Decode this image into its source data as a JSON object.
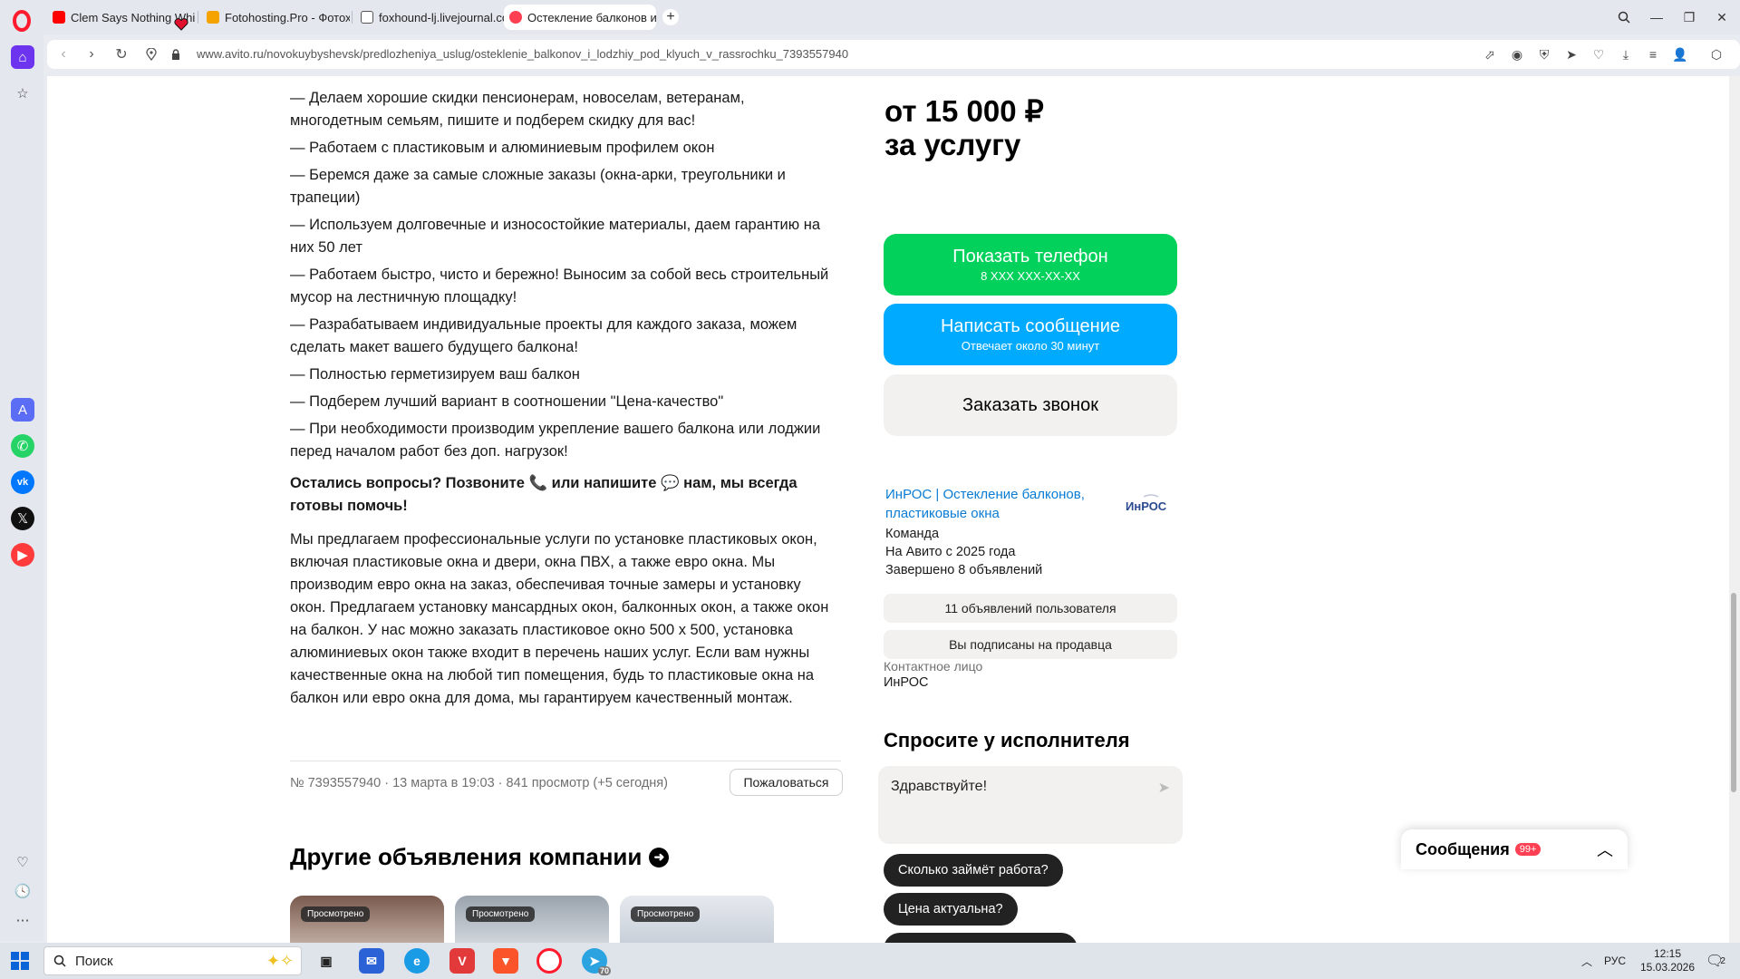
{
  "browser": {
    "tabs": [
      {
        "label": "Clem Says Nothing While",
        "color": "#ff0000"
      },
      {
        "label": "Fotohosting.Pro - Фотохо",
        "color": "#f5a300"
      },
      {
        "label": "foxhound-lj.livejournal.co",
        "color": "#555555"
      },
      {
        "label": "Остекление балконов и",
        "color": "#ff4053"
      }
    ],
    "url": "www.avito.ru/novokuybyshevsk/predlozheniya_uslug/osteklenie_balkonov_i_lodzhiy_pod_klyuch_v_rassrochku_7393557940"
  },
  "description": {
    "items": [
      "— Делаем хорошие скидки пенсионерам, новоселам, ветеранам, многодетным семьям, пишите и подберем скидку для вас!",
      "— Работаем с пластиковым и алюминиевым профилем окон",
      "— Беремся даже за самые сложные заказы (окна-арки, треугольники и трапеции)",
      "— Используем долговечные и износостойкие материалы, даем гарантию на них 50 лет",
      "— Работаем быстро, чисто и бережно! Выносим за собой весь строительный мусор на лестничную площадку!",
      "— Разрабатываем индивидуальные проекты для каждого заказа, можем сделать макет вашего будущего балкона!",
      "— Полностью герметизируем ваш балкон",
      "— Подберем лучший вариант в соотношении \"Цена-качество\"",
      "— При необходимости производим укрепление вашего балкона или лоджии перед началом работ без доп. нагрузок!"
    ],
    "question_part1": "Остались вопросы? Позвоните",
    "question_part2": "или напишите",
    "question_part3": "нам, мы всегда готовы помочь!",
    "paragraph": "Мы предлагаем профессиональные услуги по установке пластиковых окон, включая пластиковые окна и двери, окна ПВХ, а также евро окна. Мы производим евро окна на заказ, обеспечивая точные замеры и установку окон. Предлагаем установку мансардных окон, балконных окон, а также окон на балкон. У нас можно заказать пластиковое окно 500 х 500, установка алюминиевых окон также входит в перечень наших услуг. Если вам нужны качественные окна на любой тип помещения, будь то пластиковые окна на балкон или евро окна для дома, мы гарантируем качественный монтаж."
  },
  "meta": {
    "text": "№ 7393557940 · 13 марта в 19:03 · 841 просмотр (+5 сегодня)",
    "complain": "Пожаловаться"
  },
  "others": {
    "title": "Другие объявления компании",
    "badge": "Просмотрено"
  },
  "offer": {
    "price_line1": "от 15 000 ₽",
    "price_line2": "за услугу",
    "phone_btn": "Показать телефон",
    "phone_sub": "8 XXX XXX-XX-XX",
    "msg_btn": "Написать сообщение",
    "msg_sub": "Отвечает около 30 минут",
    "call_btn": "Заказать звонок"
  },
  "seller": {
    "name": "ИнРОС | Остекление балконов, пластиковые окна",
    "logo_text": "ИнРОС",
    "type": "Команда",
    "since": "На Авито с 2025 года",
    "completed": "Завершено 8 объявлений",
    "ads_btn": "11 объявлений пользователя",
    "sub_btn": "Вы подписаны на продавца",
    "contact_label": "Контактное лицо",
    "contact_name": "ИнРОС"
  },
  "ask": {
    "title": "Спросите у исполнителя",
    "input_value": "Здравствуйте!",
    "chips": [
      "Сколько займёт работа?",
      "Цена актуальна?"
    ]
  },
  "messages": {
    "title": "Сообщения",
    "badge": "99+"
  },
  "taskbar": {
    "search_placeholder": "Поиск",
    "telegram_badge": "70",
    "lang": "РУС",
    "time": "12:15",
    "date": "15.03.2026",
    "notif_count": "2"
  }
}
